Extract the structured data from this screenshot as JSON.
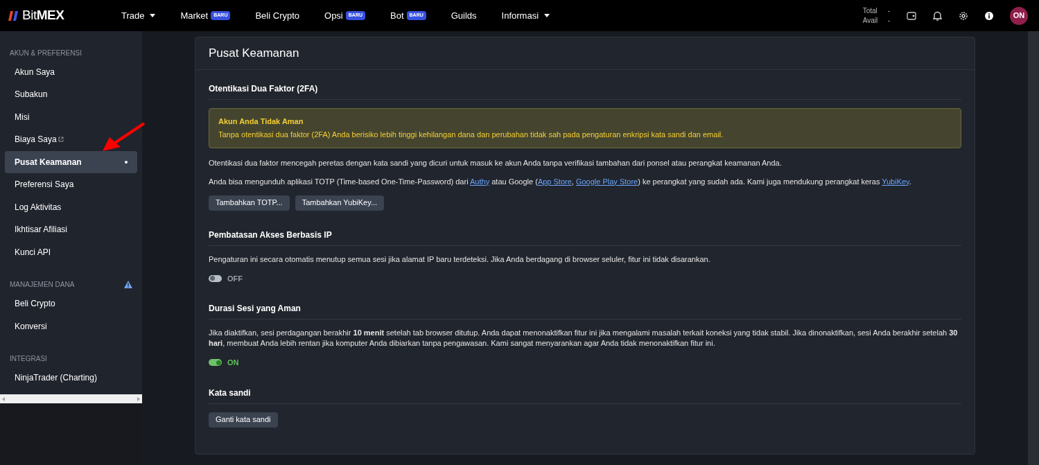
{
  "brand": {
    "name": "BitMEX"
  },
  "nav": [
    {
      "label": "Trade",
      "dropdown": true
    },
    {
      "label": "Market",
      "badge": "BARU",
      "dropdown": false
    },
    {
      "label": "Beli Crypto",
      "dropdown": false
    },
    {
      "label": "Opsi",
      "badge": "BARU",
      "dropdown": false
    },
    {
      "label": "Bot",
      "badge": "BARU",
      "dropdown": false
    },
    {
      "label": "Guilds",
      "dropdown": false
    },
    {
      "label": "Informasi",
      "dropdown": true
    }
  ],
  "balance": [
    {
      "label": "Total",
      "value": "-"
    },
    {
      "label": "Avail",
      "value": "-"
    }
  ],
  "avatar": {
    "initials": "ON"
  },
  "sidebar": [
    {
      "title": "AKUN & PREFERENSI",
      "warning": false,
      "items": [
        {
          "label": "Akun Saya",
          "selected": false,
          "external": false
        },
        {
          "label": "Subakun",
          "selected": false,
          "external": false
        },
        {
          "label": "Misi",
          "selected": false,
          "external": false
        },
        {
          "label": "Biaya Saya",
          "selected": false,
          "external": true
        },
        {
          "label": "Pusat Keamanan",
          "selected": true,
          "external": false
        },
        {
          "label": "Preferensi Saya",
          "selected": false,
          "external": false
        },
        {
          "label": "Log Aktivitas",
          "selected": false,
          "external": false
        },
        {
          "label": "Ikhtisar Afiliasi",
          "selected": false,
          "external": false
        },
        {
          "label": "Kunci API",
          "selected": false,
          "external": false
        }
      ]
    },
    {
      "title": "MANAJEMEN DANA",
      "warning": true,
      "items": [
        {
          "label": "Beli Crypto",
          "selected": false,
          "external": false
        },
        {
          "label": "Konversi",
          "selected": false,
          "external": false
        }
      ]
    },
    {
      "title": "INTEGRASI",
      "warning": false,
      "items": [
        {
          "label": "NinjaTrader (Charting)",
          "selected": false,
          "external": false
        }
      ]
    }
  ],
  "page": {
    "title": "Pusat Keamanan",
    "sections": [
      {
        "heading": "Otentikasi Dua Faktor (2FA)",
        "alert": {
          "title": "Akun Anda Tidak Aman",
          "text": "Tanpa otentikasi dua faktor (2FA) Anda berisiko lebih tinggi kehilangan dana dan perubahan tidak sah pada pengaturan enkripsi kata sandi dan email."
        },
        "paragraphs": [
          [
            {
              "kind": "text",
              "text": "Otentikasi dua faktor mencegah peretas dengan kata sandi yang dicuri untuk masuk ke akun Anda tanpa verifikasi tambahan dari ponsel atau perangkat keamanan Anda."
            }
          ],
          [
            {
              "kind": "text",
              "text": "Anda bisa mengunduh aplikasi TOTP (Time-based One-Time-Password) dari "
            },
            {
              "kind": "link",
              "text": "Authy"
            },
            {
              "kind": "text",
              "text": " atau Google ("
            },
            {
              "kind": "link",
              "text": "App Store"
            },
            {
              "kind": "text",
              "text": ", "
            },
            {
              "kind": "link",
              "text": "Google Play Store"
            },
            {
              "kind": "text",
              "text": ") ke perangkat yang sudah ada. Kami juga mendukung perangkat keras "
            },
            {
              "kind": "link",
              "text": "YubiKey"
            },
            {
              "kind": "text",
              "text": "."
            }
          ]
        ],
        "buttons": [
          "Tambahkan TOTP...",
          "Tambahkan YubiKey..."
        ]
      },
      {
        "heading": "Pembatasan Akses Berbasis IP",
        "paragraphs": [
          [
            {
              "kind": "text",
              "text": "Pengaturan ini secara otomatis menutup semua sesi jika alamat IP baru terdeteksi. Jika Anda berdagang di browser seluler, fitur ini tidak disarankan."
            }
          ]
        ],
        "toggle": {
          "on": false,
          "label": "OFF"
        }
      },
      {
        "heading": "Durasi Sesi yang Aman",
        "paragraphs": [
          [
            {
              "kind": "text",
              "text": "Jika diaktifkan, sesi perdagangan berakhir **10 menit** setelah tab browser ditutup. Anda dapat menonaktifkan fitur ini jika mengalami masalah terkait koneksi yang tidak stabil. Jika dinonaktifkan, sesi Anda berakhir setelah **30 hari**, membuat Anda lebih rentan jika komputer Anda dibiarkan tanpa pengawasan. Kami sangat menyarankan agar Anda tidak menonaktifkan fitur ini."
            }
          ]
        ],
        "toggle": {
          "on": true,
          "label": "ON"
        }
      },
      {
        "heading": "Kata sandi",
        "buttons": [
          "Ganti kata sandi"
        ]
      }
    ]
  }
}
